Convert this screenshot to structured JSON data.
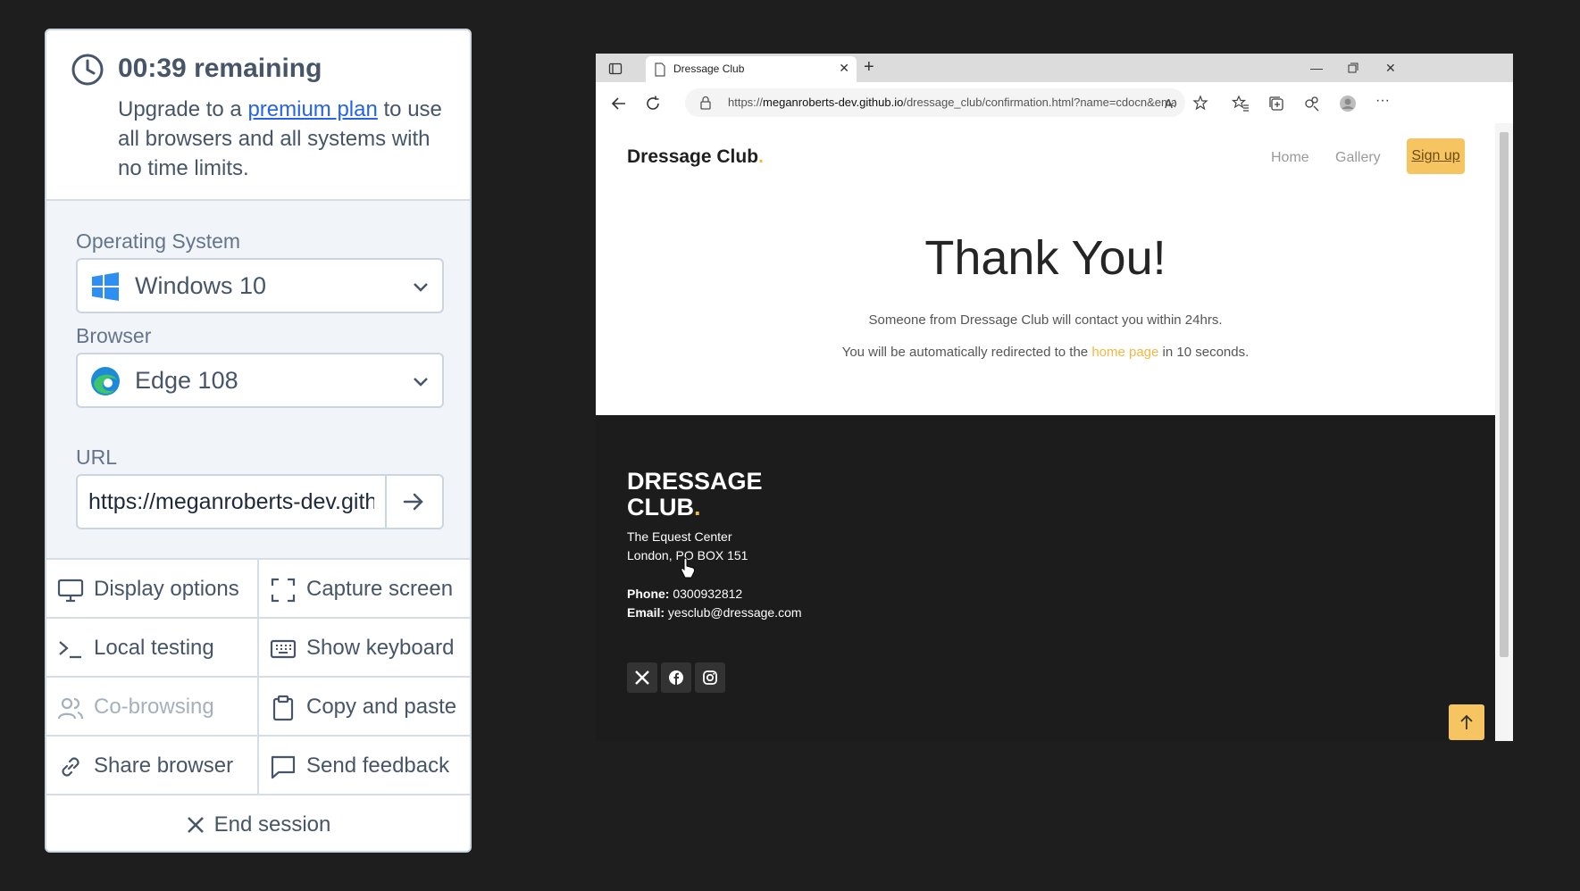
{
  "panel": {
    "timer": "00:39 remaining",
    "upgrade_pre": "Upgrade to a ",
    "upgrade_link": "premium plan",
    "upgrade_post": " to use all browsers and all systems with no time limits.",
    "os_label": "Operating System",
    "os_value": "Windows 10",
    "browser_label": "Browser",
    "browser_value": "Edge 108",
    "url_label": "URL",
    "url_value": "https://meganroberts-dev.github.io/dressage_club/confirmation.html?name=cdocn&ema",
    "actions": {
      "display_options": "Display options",
      "capture_screen": "Capture screen",
      "local_testing": "Local testing",
      "show_keyboard": "Show keyboard",
      "co_browsing": "Co-browsing",
      "copy_paste": "Copy and paste",
      "share_browser": "Share browser",
      "send_feedback": "Send feedback"
    },
    "end_session": "End session"
  },
  "browser": {
    "tab_title": "Dressage Club",
    "url_prefix": "https://",
    "url_host": "meganroberts-dev.github.io",
    "url_rest": "/dressage_club/confirmation.html?name=cdocn&ema..."
  },
  "site": {
    "brand": "Dressage Club",
    "brand_dot": ".",
    "nav_home": "Home",
    "nav_gallery": "Gallery",
    "nav_signup": "Sign up",
    "hero_title": "Thank You!",
    "hero_line1": "Someone from Dressage Club will contact you within 24hrs.",
    "hero_line2_pre": "You will be automatically redirected to the ",
    "hero_line2_link": "home page",
    "hero_line2_post": " in 10 seconds.",
    "footer_brand_1": "DRESSAGE",
    "footer_brand_2": "CLUB",
    "address_1": "The Equest Center",
    "address_2": "London, PO BOX 151",
    "phone_label": "Phone:",
    "phone": "0300932812",
    "email_label": "Email:",
    "email": "yesclub@dressage.com"
  },
  "colors": {
    "accent": "#f6c561",
    "link_blue": "#2563eb",
    "footer_bg": "#1c1c1c"
  }
}
